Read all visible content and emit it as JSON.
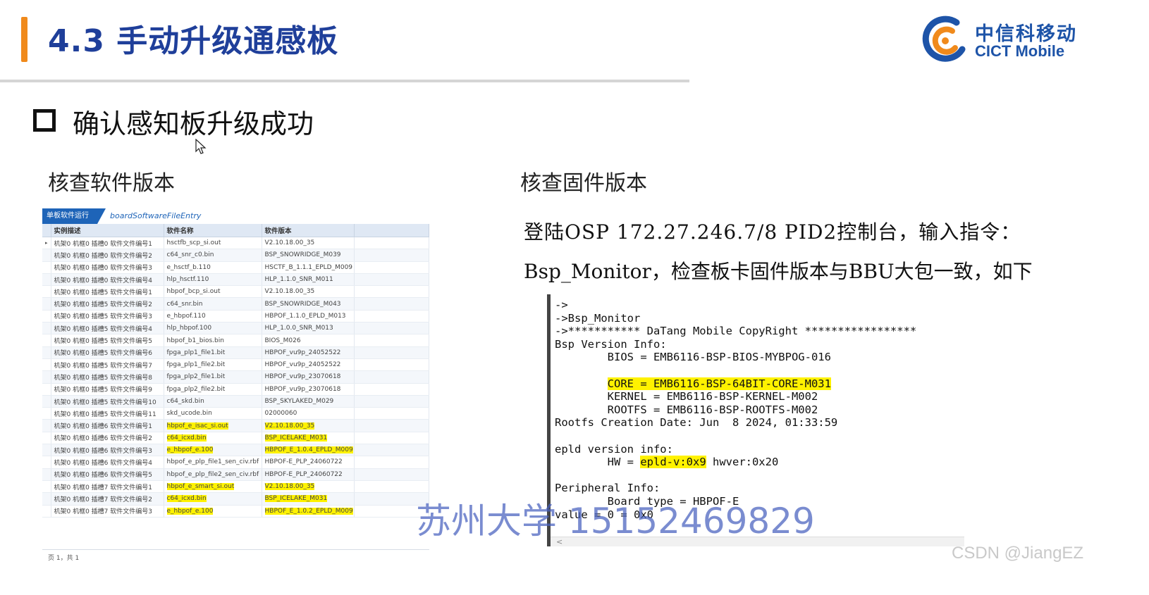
{
  "slide": {
    "title": "4.3 手动升级通感板",
    "logo_cn": "中信科移动",
    "logo_en": "CICT Mobile",
    "heading": "确认感知板升级成功",
    "sub_left": "核查软件版本",
    "sub_right": "核查固件版本",
    "desc_line1": "登陆OSP  172.27.246.7/8    PID2控制台，输入指令：",
    "desc_line2": "Bsp_Monitor，检查板卡固件版本与BBU大包一致，如下"
  },
  "panel": {
    "tab_label": "单板软件运行",
    "entry_link": "boardSoftwareFileEntry",
    "columns": [
      "实例描述",
      "软件名称",
      "软件版本"
    ],
    "rows": [
      {
        "desc": "机架0 机框0 插槽0 软件文件编号1",
        "name": "hsctfb_scp_si.out",
        "version": "V2.10.18.00_35",
        "highlight": false
      },
      {
        "desc": "机架0 机框0 插槽0 软件文件编号2",
        "name": "c64_snr_c0.bin",
        "version": "BSP_SNOWRIDGE_M039",
        "highlight": false
      },
      {
        "desc": "机架0 机框0 插槽0 软件文件编号3",
        "name": "e_hsctf_b.110",
        "version": "HSCTF_B_1.1.1_EPLD_M009",
        "highlight": false
      },
      {
        "desc": "机架0 机框0 插槽0 软件文件编号4",
        "name": "hlp_hsctf.110",
        "version": "HLP_1.1.0_SNR_M011",
        "highlight": false
      },
      {
        "desc": "机架0 机框0 插槽5 软件文件编号1",
        "name": "hbpof_bcp_si.out",
        "version": "V2.10.18.00_35",
        "highlight": false
      },
      {
        "desc": "机架0 机框0 插槽5 软件文件编号2",
        "name": "c64_snr.bin",
        "version": "BSP_SNOWRIDGE_M043",
        "highlight": false
      },
      {
        "desc": "机架0 机框0 插槽5 软件文件编号3",
        "name": "e_hbpof.110",
        "version": "HBPOF_1.1.0_EPLD_M013",
        "highlight": false
      },
      {
        "desc": "机架0 机框0 插槽5 软件文件编号4",
        "name": "hlp_hbpof.100",
        "version": "HLP_1.0.0_SNR_M013",
        "highlight": false
      },
      {
        "desc": "机架0 机框0 插槽5 软件文件编号5",
        "name": "hbpof_b1_bios.bin",
        "version": "BIOS_M026",
        "highlight": false
      },
      {
        "desc": "机架0 机框0 插槽5 软件文件编号6",
        "name": "fpga_plp1_file1.bit",
        "version": "HBPOF_vu9p_24052522",
        "highlight": false
      },
      {
        "desc": "机架0 机框0 插槽5 软件文件编号7",
        "name": "fpga_plp1_file2.bit",
        "version": "HBPOF_vu9p_24052522",
        "highlight": false
      },
      {
        "desc": "机架0 机框0 插槽5 软件文件编号8",
        "name": "fpga_plp2_file1.bit",
        "version": "HBPOF_vu9p_23070618",
        "highlight": false
      },
      {
        "desc": "机架0 机框0 插槽5 软件文件编号9",
        "name": "fpga_plp2_file2.bit",
        "version": "HBPOF_vu9p_23070618",
        "highlight": false
      },
      {
        "desc": "机架0 机框0 插槽5 软件文件编号10",
        "name": "c64_skd.bin",
        "version": "BSP_SKYLAKED_M029",
        "highlight": false
      },
      {
        "desc": "机架0 机框0 插槽5 软件文件编号11",
        "name": "skd_ucode.bin",
        "version": "02000060",
        "highlight": false
      },
      {
        "desc": "机架0 机框0 插槽6 软件文件编号1",
        "name": "hbpof_e_isac_si.out",
        "version": "V2.10.18.00_35",
        "highlight": true
      },
      {
        "desc": "机架0 机框0 插槽6 软件文件编号2",
        "name": "c64_icxd.bin",
        "version": "BSP_ICELAKE_M031",
        "highlight": true
      },
      {
        "desc": "机架0 机框0 插槽6 软件文件编号3",
        "name": "e_hbpof_e.100",
        "version": "HBPOF_E_1.0.4_EPLD_M009",
        "highlight": true
      },
      {
        "desc": "机架0 机框0 插槽6 软件文件编号4",
        "name": "hbpof_e_plp_file1_sen_civ.rbf",
        "version": "HBPOF-E_PLP_24060722",
        "highlight": false
      },
      {
        "desc": "机架0 机框0 插槽6 软件文件编号5",
        "name": "hbpof_e_plp_file2_sen_civ.rbf",
        "version": "HBPOF-E_PLP_24060722",
        "highlight": false
      },
      {
        "desc": "机架0 机框0 插槽7 软件文件编号1",
        "name": "hbpof_e_smart_si.out",
        "version": "V2.10.18.00_35",
        "highlight": true
      },
      {
        "desc": "机架0 机框0 插槽7 软件文件编号2",
        "name": "c64_icxd.bin",
        "version": "BSP_ICELAKE_M031",
        "highlight": true
      },
      {
        "desc": "机架0 机框0 插槽7 软件文件编号3",
        "name": "e_hbpof_e.100",
        "version": "HBPOF_E_1.0.2_EPLD_M009",
        "highlight": true
      }
    ],
    "footer": "页 1，共 1"
  },
  "terminal": {
    "lines": [
      {
        "text": "->"
      },
      {
        "text": "->Bsp_Monitor"
      },
      {
        "text": "->*********** DaTang Mobile CopyRight *****************"
      },
      {
        "text": "Bsp Version Info:"
      },
      {
        "text": "        BIOS = EMB6116-BSP-BIOS-MYBPOG-016"
      },
      {
        "text": ""
      },
      {
        "pre": "        ",
        "hl": "CORE = EMB6116-BSP-64BIT-CORE-M031",
        "post": ""
      },
      {
        "text": "        KERNEL = EMB6116-BSP-KERNEL-M002"
      },
      {
        "text": "        ROOTFS = EMB6116-BSP-ROOTFS-M002"
      },
      {
        "text": "Rootfs Creation Date: Jun  8 2024, 01:33:59"
      },
      {
        "text": ""
      },
      {
        "text": "epld version info:"
      },
      {
        "pre": "        HW = ",
        "hl": "epld-v:0x9",
        "post": " hwver:0x20"
      },
      {
        "text": ""
      },
      {
        "text": "Peripheral Info:"
      },
      {
        "text": "        Board type = HBPOF-E"
      },
      {
        "text": "value = 0 = 0x0"
      }
    ],
    "scroll_glyph": "<"
  },
  "overlay": {
    "watermark": "苏州大学 15152469829",
    "credit": "CSDN @JiangEZ"
  },
  "colors": {
    "title_blue": "#1f3f9a",
    "accent_orange": "#f08a1c",
    "highlight_yellow": "#fff200",
    "brand_blue": "#1e54a8"
  }
}
